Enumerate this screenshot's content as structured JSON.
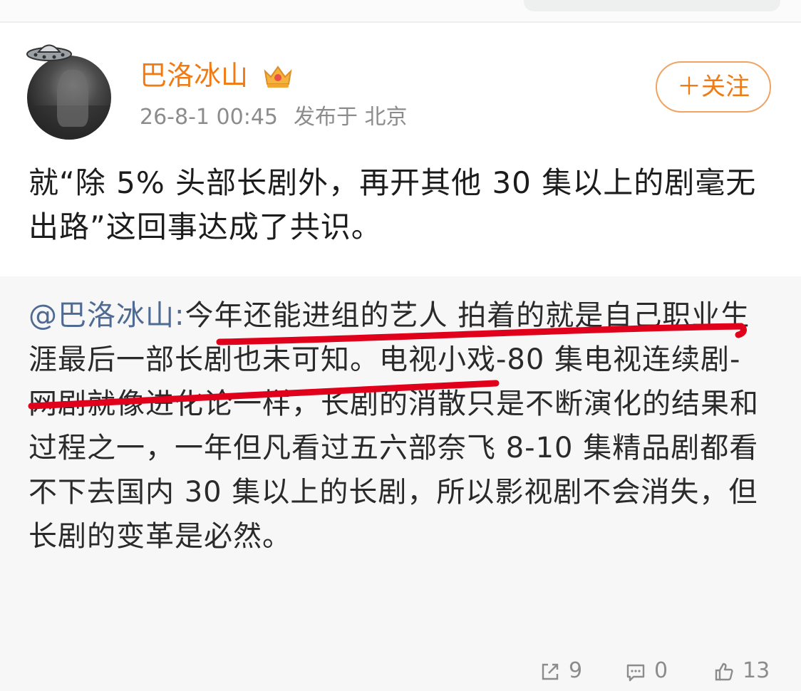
{
  "post": {
    "author": "巴洛冰山",
    "timestamp": "26-8-1 00:45",
    "location": "发布于 北京",
    "follow_label": "＋关注",
    "text": "就“除 5% 头部长剧外，再开其他 30 集以上的剧毫无出路”这回事达成了共识。"
  },
  "repost": {
    "mention": "@巴洛冰山",
    "separator": ":",
    "text": "今年还能进组的艺人 拍着的就是自己职业生涯最后一部长剧也未可知。电视小戏-80 集电视连续剧-网剧就像进化论一样，长剧的消散只是不断演化的结果和过程之一，一年但凡看过五六部奈飞 8-10 集精品剧都看不下去国内 30 集以上的长剧，所以影视剧不会消失，但长剧的变革是必然。"
  },
  "actions": {
    "share_count": "9",
    "comment_count": "0",
    "like_count": "13"
  },
  "icons": {
    "avatar_decoration": "ufo-icon",
    "badge": "crown-icon",
    "share": "share-icon",
    "comment": "comment-icon",
    "like": "thumbs-up-icon"
  },
  "colors": {
    "username": "#f07a13",
    "mention": "#4f6b94",
    "highlight_marker": "#e0001b",
    "meta_text": "#8c8c8c",
    "repost_background": "#f7f7f7"
  }
}
